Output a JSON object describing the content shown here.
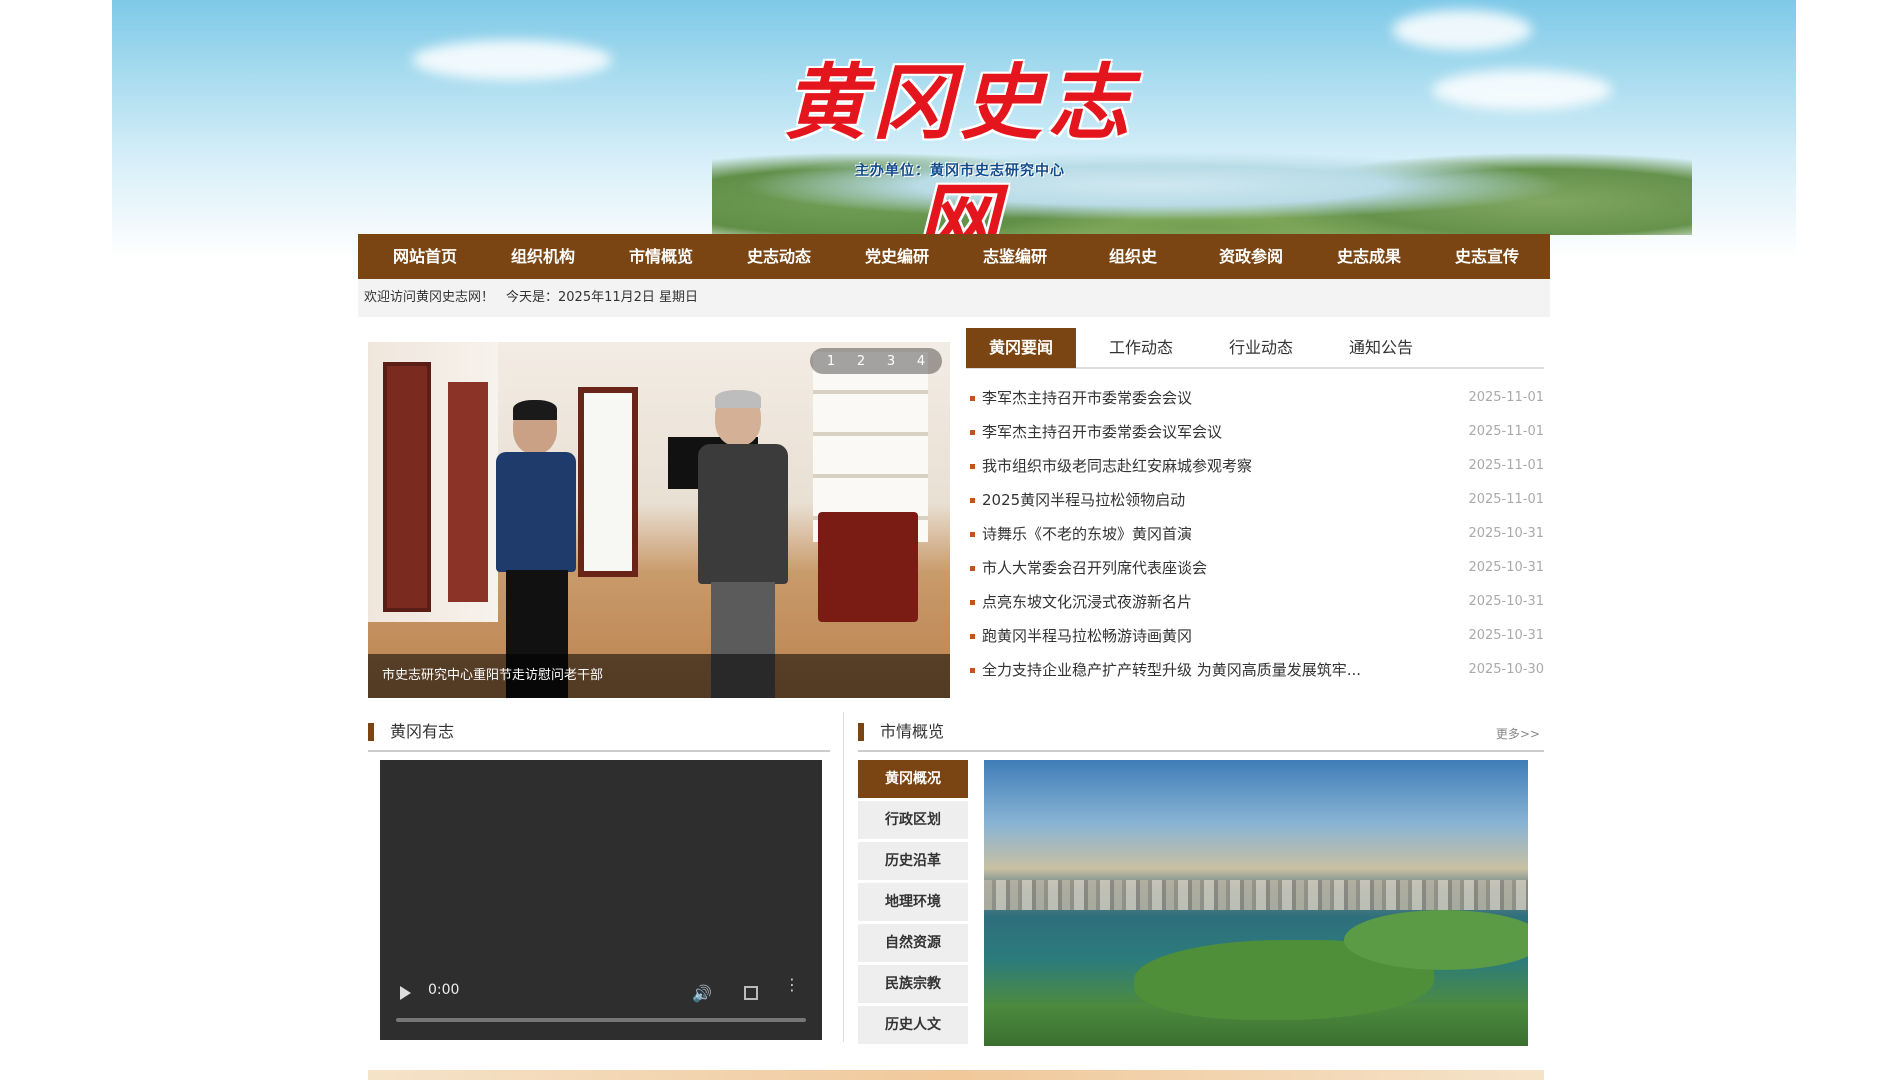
{
  "header": {
    "site_title": "黄冈史志网",
    "sponsor": "主办单位：黄冈市史志研究中心"
  },
  "nav": [
    "网站首页",
    "组织机构",
    "市情概览",
    "史志动态",
    "党史编研",
    "志鉴编研",
    "组织史",
    "资政参阅",
    "史志成果",
    "史志宣传"
  ],
  "welcome": {
    "greeting": "欢迎访问黄冈史志网！",
    "date_text": "今天是：2025年11月2日 星期日"
  },
  "slider": {
    "pages": [
      "1",
      "2",
      "3",
      "4"
    ],
    "caption": "市史志研究中心重阳节走访慰问老干部"
  },
  "news": {
    "tabs": [
      "黄冈要闻",
      "工作动态",
      "行业动态",
      "通知公告"
    ],
    "active_tab": 0,
    "items": [
      {
        "title": "李军杰主持召开市委常委会会议",
        "date": "2025-11-01"
      },
      {
        "title": "李军杰主持召开市委常委会议军会议",
        "date": "2025-11-01"
      },
      {
        "title": "我市组织市级老同志赴红安麻城参观考察",
        "date": "2025-11-01"
      },
      {
        "title": "2025黄冈半程马拉松领物启动",
        "date": "2025-11-01"
      },
      {
        "title": "诗舞乐《不老的东坡》黄冈首演",
        "date": "2025-10-31"
      },
      {
        "title": "市人大常委会召开列席代表座谈会",
        "date": "2025-10-31"
      },
      {
        "title": "点亮东坡文化沉浸式夜游新名片",
        "date": "2025-10-31"
      },
      {
        "title": "跑黄冈半程马拉松畅游诗画黄冈",
        "date": "2025-10-31"
      },
      {
        "title": "全力支持企业稳产扩产转型升级 为黄冈高质量发展筑牢...",
        "date": "2025-10-30"
      }
    ]
  },
  "section_left": {
    "title": "黄冈有志"
  },
  "section_right": {
    "title": "市情概览",
    "more": "更多>>"
  },
  "video": {
    "time": "0:00",
    "progress": 0
  },
  "side_menu": {
    "items": [
      "黄冈概况",
      "行政区划",
      "历史沿革",
      "地理环境",
      "自然资源",
      "民族宗教",
      "历史人文"
    ],
    "active": 0
  },
  "colors": {
    "brand": "#7a4512",
    "title_red": "#e4151c",
    "bullet": "#c0541c"
  }
}
